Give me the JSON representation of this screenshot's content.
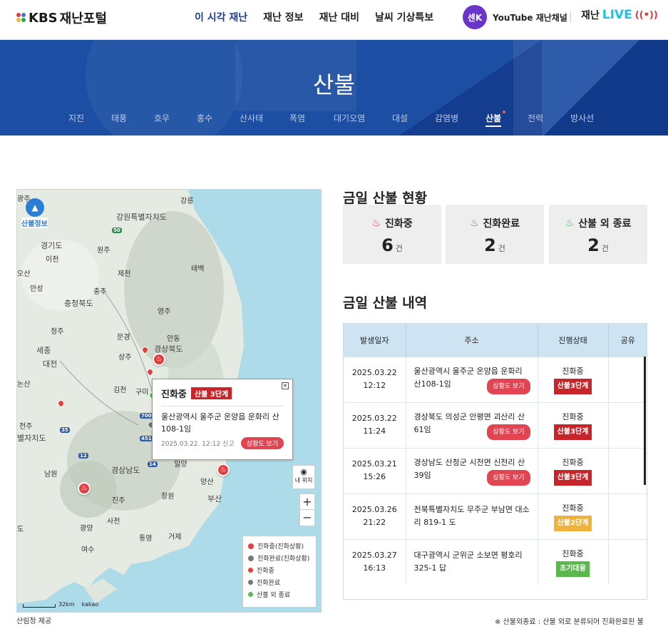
{
  "header": {
    "logo_kbs": "KBS",
    "logo_text": "재난포털",
    "nav": [
      "이 시각 재난",
      "재난 정보",
      "재난 대비",
      "날씨 기상특보"
    ],
    "youtube_avatar": "센K",
    "youtube_label": "YouTube 재난채널",
    "live_prefix": "재난",
    "live_word": "LIVE",
    "live_icon": "((•))"
  },
  "banner": {
    "title": "산불",
    "tabs": [
      "지진",
      "태풍",
      "호우",
      "홍수",
      "산사태",
      "폭염",
      "대기오염",
      "대설",
      "감염병",
      "산불",
      "전력",
      "방사선"
    ],
    "active_tab": "산불"
  },
  "map": {
    "service_title": "산불정보",
    "labels": {
      "gangwon": "강원특별자치도",
      "gyeonggi": "경기도",
      "chungbuk": "충청북도",
      "gyeongbuk": "경상북도",
      "gyeongnam": "경상남도",
      "jeonbuk": "별자치도",
      "sejong": "세종",
      "daejeon": "대전",
      "busan": "부산",
      "wonju": "원주",
      "icheon": "이천",
      "chungju": "충주",
      "jecheon": "제천",
      "taebaek": "태백",
      "yeongju": "영주",
      "andong": "안동",
      "mungyeong": "문경",
      "sangju": "상주",
      "gimcheon": "김천",
      "gumi": "구미",
      "cheongju": "청주",
      "nonsan": "논산",
      "jeonju": "전주",
      "namwon": "남원",
      "jinju": "진주",
      "changwon": "창원",
      "yangsan": "양산",
      "geoje": "거제",
      "tongyeong": "통영",
      "sacheon": "사천",
      "gwangyang": "광양",
      "yeosu": "여수",
      "miryang": "밀양",
      "gangneung": "강릉",
      "osan": "오산",
      "gwangju_d": "광주",
      "anseong": "안성",
      "jindo": "도",
      "goheung": "도"
    },
    "popup": {
      "status": "진화중",
      "level": "산불 3단계",
      "address": "울산광역시 울주군 온양읍 운화리 산108-1임",
      "time": "2025.03.22. 12:12 신고",
      "view_button": "상황도 보기",
      "close": "×"
    },
    "my_location": "내 위치",
    "zoom_in": "+",
    "zoom_out": "−",
    "legend": [
      "진화중(진화상황)",
      "진화완료(진화상황)",
      "진화중",
      "진화완료",
      "산불 외 종료"
    ],
    "scale": "32km",
    "kakao": "kakao"
  },
  "source_note": "산림청 제공",
  "summary": {
    "title": "금일 산불 현황",
    "unit": "건",
    "items": [
      {
        "label": "진화중",
        "count": "6",
        "color": "#e23f3f"
      },
      {
        "label": "진화완료",
        "count": "2",
        "color": "#777777"
      },
      {
        "label": "산불 외 종료",
        "count": "2",
        "color": "#4caf50"
      }
    ]
  },
  "history": {
    "title": "금일 산불 내역",
    "headers": [
      "발생일자",
      "주소",
      "진행상태",
      "공유"
    ],
    "rows": [
      {
        "date": "2025.03.22",
        "time": "12:12",
        "address": "울산광역시 울주군 온양읍 운화리 산108-1임",
        "view": "상황도 보기",
        "status": "진화중",
        "level": "산불3단계",
        "level_color": "red"
      },
      {
        "date": "2025.03.22",
        "time": "11:24",
        "address": "경상북도 의성군 안평면 괴산리 산61임",
        "view": "상황도 보기",
        "status": "진화중",
        "level": "산불3단계",
        "level_color": "red"
      },
      {
        "date": "2025.03.21",
        "time": "15:26",
        "address": "경상남도 산청군 시천면 신천리 산39임",
        "view": "상황도 보기",
        "status": "진화중",
        "level": "산불3단계",
        "level_color": "red"
      },
      {
        "date": "2025.03.26",
        "time": "21:22",
        "address": "전북특별자치도 무주군 부남면 대소리 819-1 도",
        "view": "",
        "status": "진화중",
        "level": "산불2단계",
        "level_color": "yel"
      },
      {
        "date": "2025.03.27",
        "time": "16:13",
        "address": "대구광역시 군위군 소보면 평호리 325-1 답",
        "view": "",
        "status": "진화중",
        "level": "초기대응",
        "level_color": "grn"
      }
    ]
  },
  "footnote": "※ 산불외종료 : 산불 외로 분류되어 진화완료된 불"
}
